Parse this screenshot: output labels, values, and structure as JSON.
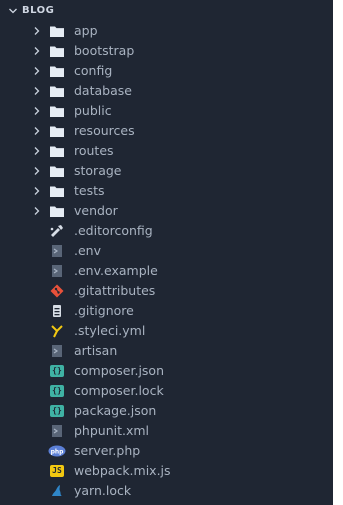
{
  "explorer": {
    "root_label": "BLOG",
    "folders": [
      {
        "label": "app"
      },
      {
        "label": "bootstrap"
      },
      {
        "label": "config"
      },
      {
        "label": "database"
      },
      {
        "label": "public"
      },
      {
        "label": "resources"
      },
      {
        "label": "routes"
      },
      {
        "label": "storage"
      },
      {
        "label": "tests"
      },
      {
        "label": "vendor"
      }
    ],
    "files": [
      {
        "label": ".editorconfig",
        "icon": "editorconfig-icon"
      },
      {
        "label": ".env",
        "icon": "env-file-icon"
      },
      {
        "label": ".env.example",
        "icon": "env-file-icon"
      },
      {
        "label": ".gitattributes",
        "icon": "git-icon"
      },
      {
        "label": ".gitignore",
        "icon": "gitignore-icon"
      },
      {
        "label": ".styleci.yml",
        "icon": "yaml-icon"
      },
      {
        "label": "artisan",
        "icon": "generic-file-icon"
      },
      {
        "label": "composer.json",
        "icon": "json-icon"
      },
      {
        "label": "composer.lock",
        "icon": "json-icon"
      },
      {
        "label": "package.json",
        "icon": "json-icon"
      },
      {
        "label": "phpunit.xml",
        "icon": "xml-icon"
      },
      {
        "label": "server.php",
        "icon": "php-icon"
      },
      {
        "label": "webpack.mix.js",
        "icon": "javascript-icon"
      },
      {
        "label": "yarn.lock",
        "icon": "yarn-icon"
      }
    ]
  },
  "colors": {
    "background": "#1f2633",
    "text": "#a9b3c1",
    "folder": "#e6ecf4",
    "json": "#3fb2a4",
    "git": "#e8513a",
    "yaml": "#f2c811",
    "php": "#5b7fd6",
    "js": "#f2c811",
    "yarn": "#2f86c9"
  }
}
